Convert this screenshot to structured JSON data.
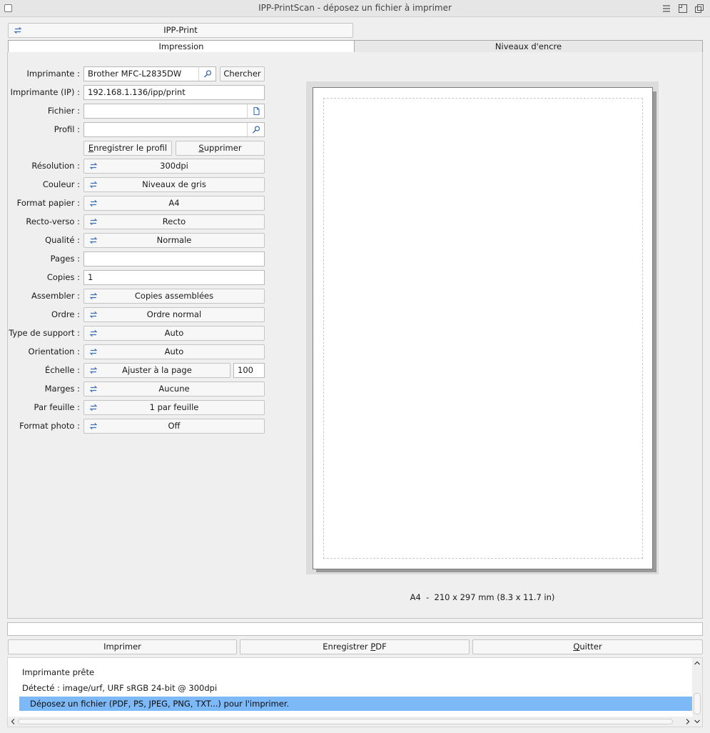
{
  "window": {
    "title": "IPP-PrintScan - déposez un fichier à imprimer"
  },
  "mode_selector": {
    "value": "IPP-Print"
  },
  "tabs": [
    {
      "label": "Impression",
      "active": true
    },
    {
      "label": "Niveaux d'encre",
      "active": false
    }
  ],
  "form": {
    "printer": {
      "label": "Imprimante :",
      "value": "Brother MFC-L2835DW",
      "search_button": "Chercher"
    },
    "printer_ip": {
      "label": "Imprimante (IP) :",
      "value": "192.168.1.136/ipp/print"
    },
    "file": {
      "label": "Fichier :",
      "value": ""
    },
    "profile": {
      "label": "Profil :",
      "value": ""
    },
    "save_profile_button": {
      "prefix": "",
      "underlined": "E",
      "rest": "nregistrer le profil"
    },
    "delete_button": {
      "prefix": "",
      "underlined": "S",
      "rest": "upprimer"
    },
    "resolution": {
      "label": "Résolution :",
      "value": "300dpi"
    },
    "color": {
      "label": "Couleur :",
      "value": "Niveaux de gris"
    },
    "paper_format": {
      "label": "Format papier :",
      "value": "A4"
    },
    "duplex": {
      "label": "Recto-verso :",
      "value": "Recto"
    },
    "quality": {
      "label": "Qualité :",
      "value": "Normale"
    },
    "pages": {
      "label": "Pages :",
      "value": ""
    },
    "copies": {
      "label": "Copies :",
      "value": "1"
    },
    "collate": {
      "label": "Assembler :",
      "value": "Copies assemblées"
    },
    "order": {
      "label": "Ordre :",
      "value": "Ordre normal"
    },
    "media_type": {
      "label": "Type de support :",
      "value": "Auto"
    },
    "orientation": {
      "label": "Orientation :",
      "value": "Auto"
    },
    "scale": {
      "label": "Échelle :",
      "value": "Ajuster à la page",
      "percent": "100"
    },
    "margins": {
      "label": "Marges :",
      "value": "Aucune"
    },
    "per_sheet": {
      "label": "Par feuille :",
      "value": "1 par feuille"
    },
    "photo_format": {
      "label": "Format photo :",
      "value": "Off"
    }
  },
  "preview": {
    "caption": "A4  -  210 x 297 mm (8.3 x 11.7 in)"
  },
  "actions": {
    "print": {
      "prefix": "Imprimer",
      "underlined": "",
      "rest": ""
    },
    "save_pdf": {
      "prefix": "Enregistrer ",
      "underlined": "P",
      "rest": "DF"
    },
    "quit": {
      "prefix": "",
      "underlined": "Q",
      "rest": "uitter"
    }
  },
  "log": [
    "Imprimante prête",
    "Détecté : image/urf, URF sRGB 24-bit @ 300dpi",
    "Déposez un fichier (PDF, PS, JPEG, PNG, TXT...) pour l'imprimer."
  ],
  "colors": {
    "accent_selection": "#7db9f6",
    "swap_icon": "#3d6fb5"
  }
}
